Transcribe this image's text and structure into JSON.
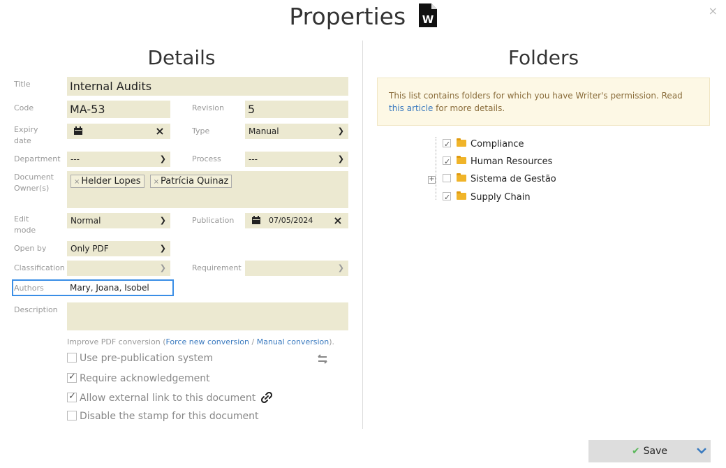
{
  "dialog": {
    "title": "Properties",
    "close": "×"
  },
  "details": {
    "heading": "Details",
    "title_label": "Title",
    "title_value": "Internal Audits",
    "code_label": "Code",
    "code_value": "MA-53",
    "revision_label": "Revision",
    "revision_value": "5",
    "expiry_label_1": "Expiry",
    "expiry_label_2": "date",
    "expiry_value": "",
    "type_label": "Type",
    "type_value": "Manual",
    "department_label": "Department",
    "department_value": "---",
    "process_label": "Process",
    "process_value": "---",
    "owners_label_1": "Document",
    "owners_label_2": "Owner(s)",
    "owners": [
      "Helder Lopes",
      "Patrícia Quinaz"
    ],
    "edit_mode_label_1": "Edit",
    "edit_mode_label_2": "mode",
    "edit_mode_value": "Normal",
    "publication_label": "Publication",
    "publication_value": "07/05/2024",
    "open_by_label": "Open by",
    "open_by_value": "Only PDF",
    "classification_label": "Classification",
    "classification_value": "",
    "requirement_label": "Requirement",
    "requirement_value": "",
    "authors_label": "Authors",
    "authors_value": "Mary, Joana, Isobel",
    "description_label": "Description",
    "description_value": "",
    "improve_prefix": "Improve PDF conversion (",
    "force_link": "Force new conversion",
    "sep": " / ",
    "manual_link": "Manual conversion",
    "improve_suffix": ").",
    "options": [
      {
        "label": "Use pre-publication system",
        "checked": false
      },
      {
        "label": "Require acknowledgement",
        "checked": true
      },
      {
        "label": "Allow external link to this document",
        "checked": true
      },
      {
        "label": "Disable the stamp for this document",
        "checked": false
      }
    ]
  },
  "folders": {
    "heading": "Folders",
    "notice_text": "This list contains folders for which you have Writer's permission. Read ",
    "notice_link": "this article",
    "notice_suffix": " for more details.",
    "items": [
      {
        "label": "Compliance",
        "checked": true,
        "expandable": false
      },
      {
        "label": "Human Resources",
        "checked": true,
        "expandable": false
      },
      {
        "label": "Sistema de Gestão",
        "checked": false,
        "expandable": true
      },
      {
        "label": "Supply Chain",
        "checked": true,
        "expandable": false
      }
    ]
  },
  "footer": {
    "save_label": "Save"
  },
  "colors": {
    "field_bg": "#ece9d1",
    "accent": "#3a7abf",
    "notice_bg": "#fdf8e5",
    "focus": "#3a8ee6"
  }
}
